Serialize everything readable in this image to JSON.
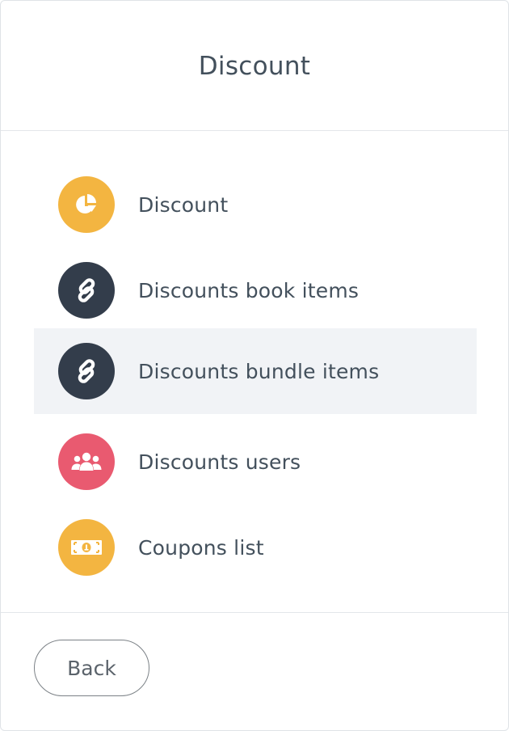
{
  "header": {
    "title": "Discount"
  },
  "menu": {
    "items": [
      {
        "label": "Discount",
        "icon": "pie-chart-icon",
        "color": "#f3b541",
        "active": false
      },
      {
        "label": "Discounts book items",
        "icon": "link-icon",
        "color": "#333d4b",
        "active": false
      },
      {
        "label": "Discounts bundle items",
        "icon": "link-icon",
        "color": "#333d4b",
        "active": true
      },
      {
        "label": "Discounts users",
        "icon": "users-icon",
        "color": "#e95a70",
        "active": false
      },
      {
        "label": "Coupons list",
        "icon": "money-bill-icon",
        "color": "#f3b541",
        "active": false
      }
    ]
  },
  "footer": {
    "back_label": "Back"
  },
  "colors": {
    "active_row_background": "#f1f3f6",
    "text": "#43505c",
    "border": "#e3e6ea"
  }
}
